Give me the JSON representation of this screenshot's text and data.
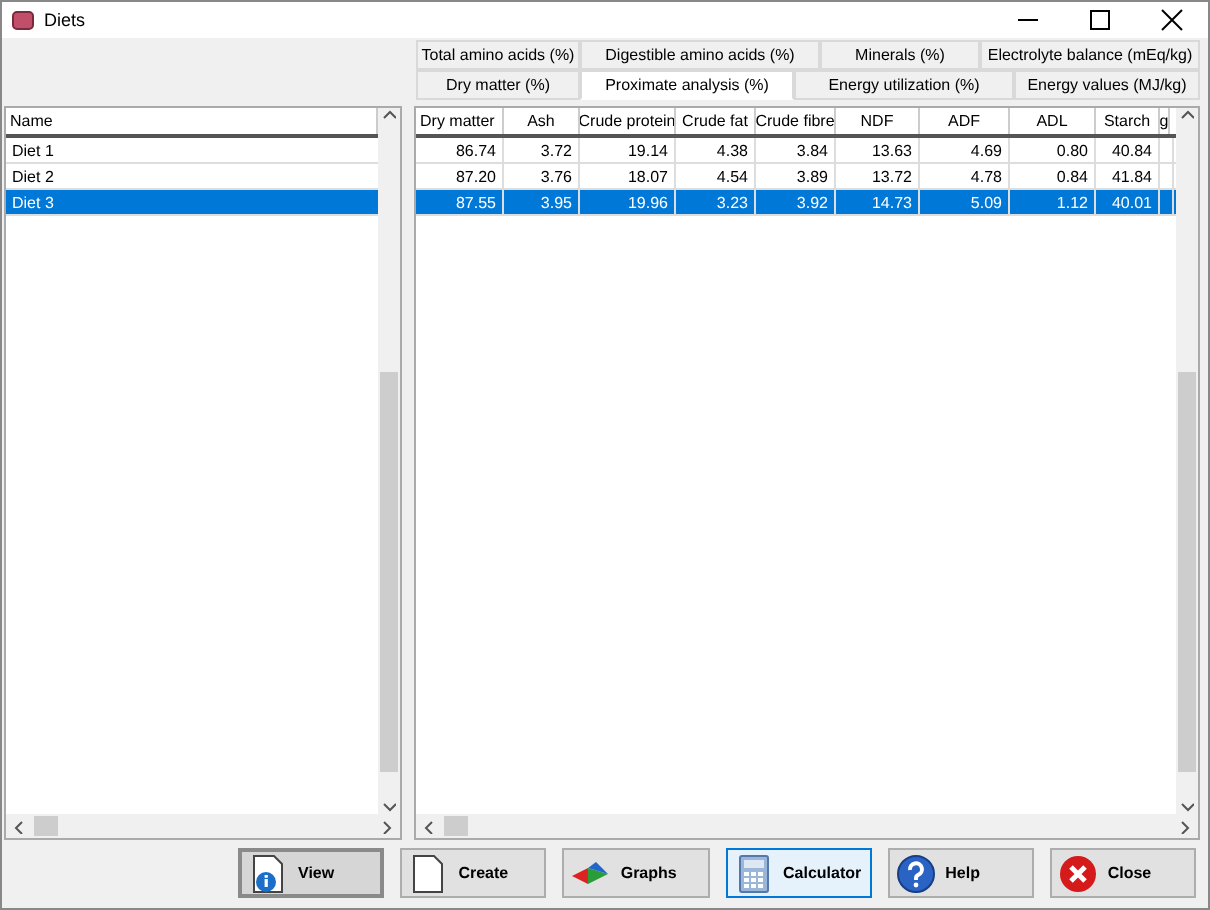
{
  "window": {
    "title": "Diets"
  },
  "tab_rows": [
    [
      {
        "label": "Total amino acids (%)",
        "selected": false
      },
      {
        "label": "Digestible amino acids (%)",
        "selected": false
      },
      {
        "label": "Minerals (%)",
        "selected": false
      },
      {
        "label": "Electrolyte balance (mEq/kg)",
        "selected": false
      }
    ],
    [
      {
        "label": "Dry matter (%)",
        "selected": false
      },
      {
        "label": "Proximate analysis (%)",
        "selected": true
      },
      {
        "label": "Energy utilization (%)",
        "selected": false
      },
      {
        "label": "Energy values (MJ/kg)",
        "selected": false
      }
    ]
  ],
  "name_list": {
    "column": "Name",
    "rows": [
      {
        "name": "Diet 1",
        "selected": false
      },
      {
        "name": "Diet 2",
        "selected": false
      },
      {
        "name": "Diet 3",
        "selected": true
      }
    ]
  },
  "table": {
    "columns": [
      "Dry matter",
      "Ash",
      "Crude protein",
      "Crude fat",
      "Crude fibre",
      "NDF",
      "ADF",
      "ADL",
      "Starch",
      "g"
    ],
    "rows": [
      {
        "selected": false,
        "cells": [
          "86.74",
          "3.72",
          "19.14",
          "4.38",
          "3.84",
          "13.63",
          "4.69",
          "0.80",
          "40.84",
          ""
        ]
      },
      {
        "selected": false,
        "cells": [
          "87.20",
          "3.76",
          "18.07",
          "4.54",
          "3.89",
          "13.72",
          "4.78",
          "0.84",
          "41.84",
          ""
        ]
      },
      {
        "selected": true,
        "cells": [
          "87.55",
          "3.95",
          "19.96",
          "3.23",
          "3.92",
          "14.73",
          "5.09",
          "1.12",
          "40.01",
          ""
        ]
      }
    ]
  },
  "buttons": [
    {
      "label": "View",
      "kind": "view",
      "highlighted": false,
      "default": true
    },
    {
      "label": "Create",
      "kind": "create",
      "highlighted": false,
      "default": false
    },
    {
      "label": "Graphs",
      "kind": "graphs",
      "highlighted": false,
      "default": false
    },
    {
      "label": "Calculator",
      "kind": "calculator",
      "highlighted": true,
      "default": false
    },
    {
      "label": "Help",
      "kind": "help",
      "highlighted": false,
      "default": false
    },
    {
      "label": "Close",
      "kind": "close",
      "highlighted": false,
      "default": false
    }
  ]
}
